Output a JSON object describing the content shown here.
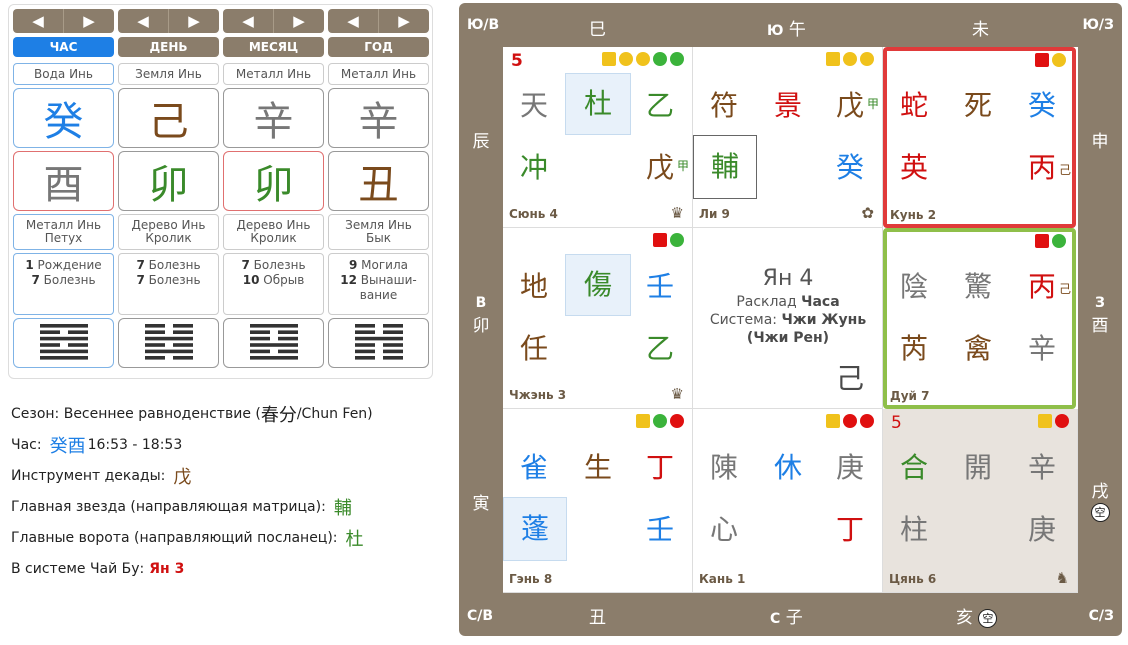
{
  "pillars": [
    {
      "tab": "ЧАС",
      "active": true,
      "element": "Вода Инь",
      "stem": "癸",
      "stem_color": "blue",
      "branch": "酉",
      "branch_color": "gray",
      "desc1": "Металл Инь",
      "desc2": "Петух",
      "phase1_num": "1",
      "phase1": "Рождение",
      "phase2_num": "7",
      "phase2": "Болезнь",
      "hexagram": [
        [
          1,
          1
        ],
        [
          0,
          0
        ],
        [
          1,
          1
        ],
        [
          0,
          1
        ],
        [
          1,
          1
        ],
        [
          1,
          1
        ]
      ]
    },
    {
      "tab": "ДЕНЬ",
      "active": false,
      "element": "Земля Инь",
      "stem": "己",
      "stem_color": "brown",
      "branch": "卯",
      "branch_color": "green",
      "desc1": "Дерево Инь",
      "desc2": "Кролик",
      "phase1_num": "7",
      "phase1": "Болезнь",
      "phase2_num": "7",
      "phase2": "Болезнь",
      "hexagram": [
        [
          0,
          1
        ],
        [
          0,
          1
        ],
        [
          1,
          1
        ],
        [
          0,
          1
        ],
        [
          1,
          1
        ],
        [
          0,
          1
        ]
      ]
    },
    {
      "tab": "МЕСЯЦ",
      "active": false,
      "element": "Металл Инь",
      "stem": "辛",
      "stem_color": "gray",
      "branch": "卯",
      "branch_color": "green",
      "desc1": "Дерево Инь",
      "desc2": "Кролик",
      "phase1_num": "7",
      "phase1": "Болезнь",
      "phase2_num": "10",
      "phase2": "Обрыв",
      "hexagram": [
        [
          1,
          1
        ],
        [
          0,
          1
        ],
        [
          0,
          1
        ],
        [
          1,
          1
        ],
        [
          0,
          1
        ],
        [
          1,
          1
        ]
      ]
    },
    {
      "tab": "ГОД",
      "active": false,
      "element": "Металл Инь",
      "stem": "辛",
      "stem_color": "gray",
      "branch": "丑",
      "branch_color": "brown",
      "desc1": "Земля Инь",
      "desc2": "Бык",
      "phase1_num": "9",
      "phase1": "Могила",
      "phase2_num": "12",
      "phase2": "Вынаши-вание",
      "hexagram": [
        [
          0,
          1
        ],
        [
          0,
          1
        ],
        [
          1,
          1
        ],
        [
          0,
          1
        ],
        [
          0,
          1
        ],
        [
          0,
          1
        ]
      ]
    }
  ],
  "info": {
    "season_label": "Сезон: Весеннее равноденствие (",
    "season_han": "春分",
    "season_rest": "/Chun Fen)",
    "hour_label": "Час:",
    "hour_han": "癸酉",
    "hour_time": "16:53 - 18:53",
    "decade_label": "Инструмент декады:",
    "decade_han": "戊",
    "star_label": "Главная звезда (направляющая матрица):",
    "star_han": "輔",
    "gate_label": "Главные ворота (направляющий посланец):",
    "gate_han": "杜",
    "chaibu_label": "В системе Чай Бу:",
    "chaibu_value": "Ян 3"
  },
  "board": {
    "corner_nw": "Ю/В",
    "corner_ne": "Ю/З",
    "corner_sw": "С/В",
    "corner_se": "С/З",
    "top": [
      "巳",
      "午",
      "未"
    ],
    "top_mid_letter": "Ю",
    "bottom": [
      "丑",
      "子",
      "亥"
    ],
    "bottom_mid_letter": "С",
    "left": [
      "辰",
      "卯",
      "寅"
    ],
    "left_mid_letter": "В",
    "right": [
      "申",
      "酉",
      "戌"
    ],
    "right_mid_letter": "З",
    "void_glyph": "空",
    "center": {
      "line1": "Ян 4",
      "line2a": "Расклад ",
      "line2b": "Часа",
      "line3a": "Система: ",
      "line3b": "Чжи Жунь",
      "line4": "(Чжи Рен)",
      "stem": "己"
    }
  },
  "cells": [
    {
      "name": "Сюнь 4",
      "num": "5",
      "icon": "♛",
      "deity": "天",
      "door": "杜",
      "stem_top": "乙",
      "star": "冲",
      "stem_bot": "戊",
      "stem_bot_sup": "甲"
    },
    {
      "name": "Ли 9",
      "icon": "✿",
      "deity": "符",
      "door": "景",
      "stem_top": "戊",
      "stem_top_sup": "甲",
      "star": "輔",
      "stem_bot": "癸"
    },
    {
      "name": "Кунь 2",
      "deity": "蛇",
      "door": "死",
      "stem_top": "癸",
      "star": "英",
      "stem_bot": "丙",
      "stem_bot_sub": "己"
    },
    {
      "name": "Чжэнь 3",
      "icon": "♛",
      "deity": "地",
      "door": "傷",
      "stem_top": "壬",
      "star": "任",
      "stem_bot": "乙"
    },
    {
      "name": "Дуй 7",
      "deity": "陰",
      "door": "驚",
      "stem_top": "丙",
      "stem_top_sub": "己",
      "star": "芮",
      "star2": "禽",
      "stem_bot": "辛"
    },
    {
      "name": "Гэнь 8",
      "deity": "雀",
      "door": "生",
      "stem_top": "丁",
      "star": "蓬",
      "stem_bot": "壬"
    },
    {
      "name": "Кань 1",
      "deity": "陳",
      "door": "休",
      "stem_top": "庚",
      "star": "心",
      "stem_bot": "丁"
    },
    {
      "name": "Цянь 6",
      "num": "5",
      "icon": "♞",
      "deity": "合",
      "door": "開",
      "stem_top": "辛",
      "star": "柱",
      "stem_bot": "庚"
    }
  ],
  "colors": {
    "blue": "#1e7fe5",
    "brown": "#7a4a1c",
    "green": "#3a8a2a",
    "gray": "#777777",
    "red": "#d01010",
    "board": "#8b7d6b",
    "highlight_red": "#e03a3a",
    "highlight_green": "#8fbf4a"
  }
}
